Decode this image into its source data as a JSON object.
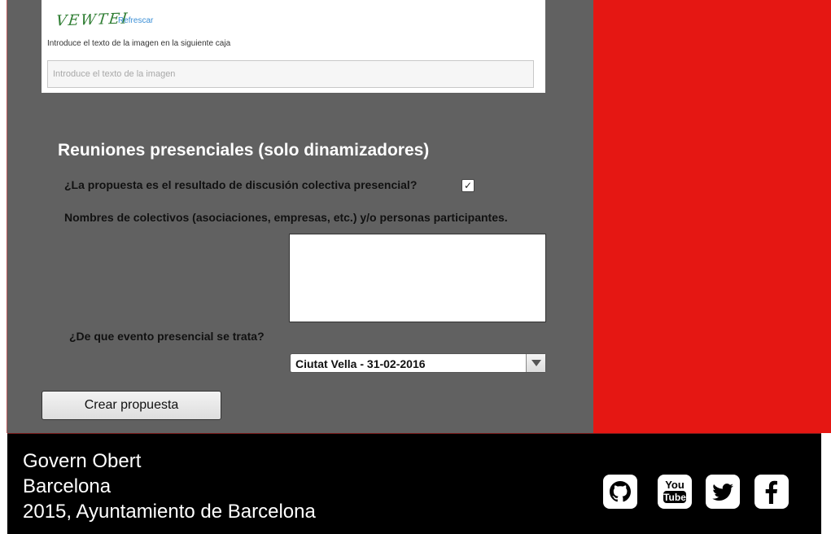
{
  "captcha": {
    "image_text": "VEWTEI",
    "refresh_label": "Refrescar",
    "instruction": "Introduce el texto de la imagen en la siguiente caja",
    "input_placeholder": "Introduce el texto de la imagen",
    "input_value": ""
  },
  "meetings": {
    "title": "Reuniones presenciales (solo dinamizadores)",
    "collective_question": "¿La propuesta es el resultado de discusión colectiva presencial?",
    "collective_checked": true,
    "participants_label": "Nombres de colectivos (asociaciones, empresas, etc.) y/o personas participantes.",
    "participants_value": "",
    "event_label": "¿De que evento presencial se trata?",
    "event_selected": "Ciutat Vella - 31-02-2016"
  },
  "actions": {
    "create_label": "Crear propuesta"
  },
  "footer": {
    "line1": "Govern Obert",
    "line2": "Barcelona",
    "line3": "2015, Ayuntamiento de Barcelona",
    "social_icons": [
      "github-icon",
      "youtube-icon",
      "twitter-icon",
      "facebook-icon"
    ]
  },
  "colors": {
    "main_panel": "#616161",
    "side_panel": "#e51713",
    "footer": "#000000"
  }
}
